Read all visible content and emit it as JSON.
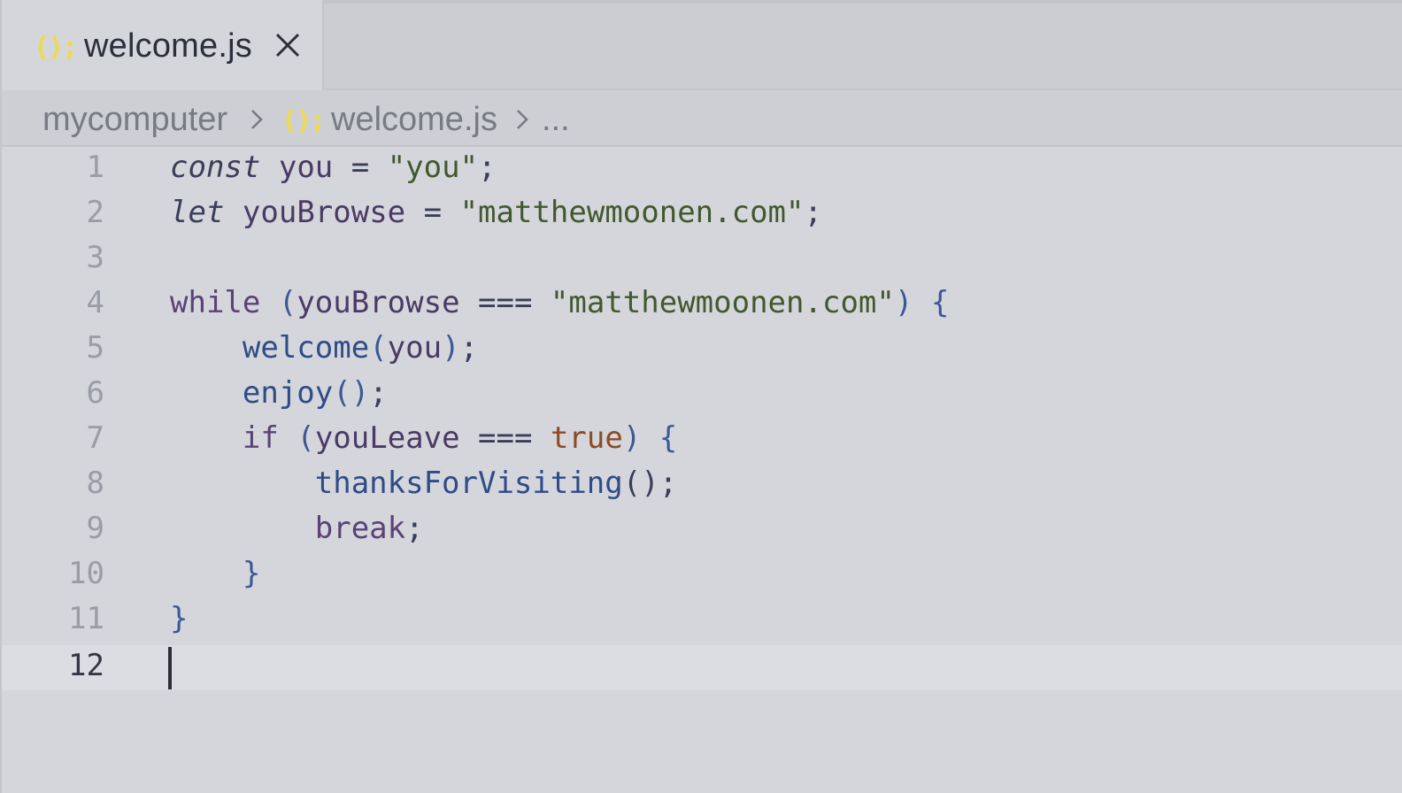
{
  "tab": {
    "icon": "();",
    "label": "welcome.js",
    "close_icon": "close-icon"
  },
  "breadcrumb": {
    "folder": "mycomputer",
    "file_icon": "();",
    "file": "welcome.js",
    "more": "..."
  },
  "editor": {
    "lines": [
      {
        "num": "1"
      },
      {
        "num": "2"
      },
      {
        "num": "3"
      },
      {
        "num": "4"
      },
      {
        "num": "5"
      },
      {
        "num": "6"
      },
      {
        "num": "7"
      },
      {
        "num": "8"
      },
      {
        "num": "9"
      },
      {
        "num": "10"
      },
      {
        "num": "11"
      },
      {
        "num": "12"
      }
    ],
    "current_line": 12,
    "code": {
      "l1": [
        "const",
        " ",
        "you",
        " = ",
        "\"you\"",
        ";"
      ],
      "l2": [
        "let",
        " ",
        "youBrowse",
        " = ",
        "\"matthewmoonen.com\"",
        ";"
      ],
      "l4": [
        "while",
        " ",
        "(",
        "youBrowse",
        " === ",
        "\"matthewmoonen.com\"",
        ")",
        " ",
        "{"
      ],
      "l5": [
        "    ",
        "welcome",
        "(",
        "you",
        ")",
        ";"
      ],
      "l6": [
        "    ",
        "enjoy",
        "()",
        ";"
      ],
      "l7": [
        "    ",
        "if",
        " ",
        "(",
        "youLeave",
        " === ",
        "true",
        ")",
        " ",
        "{"
      ],
      "l8": [
        "        ",
        "thanksForVisiting",
        "()",
        ";"
      ],
      "l9": [
        "        ",
        "break",
        ";"
      ],
      "l10": [
        "    ",
        "}"
      ],
      "l11": [
        "}"
      ]
    }
  },
  "colors": {
    "string": "#42582e",
    "function": "#2f4c86",
    "boolean": "#8c4b22",
    "keyword": "#5b4276",
    "js_icon": "#f0d94a",
    "tab_active_border": "#5a74b4"
  }
}
